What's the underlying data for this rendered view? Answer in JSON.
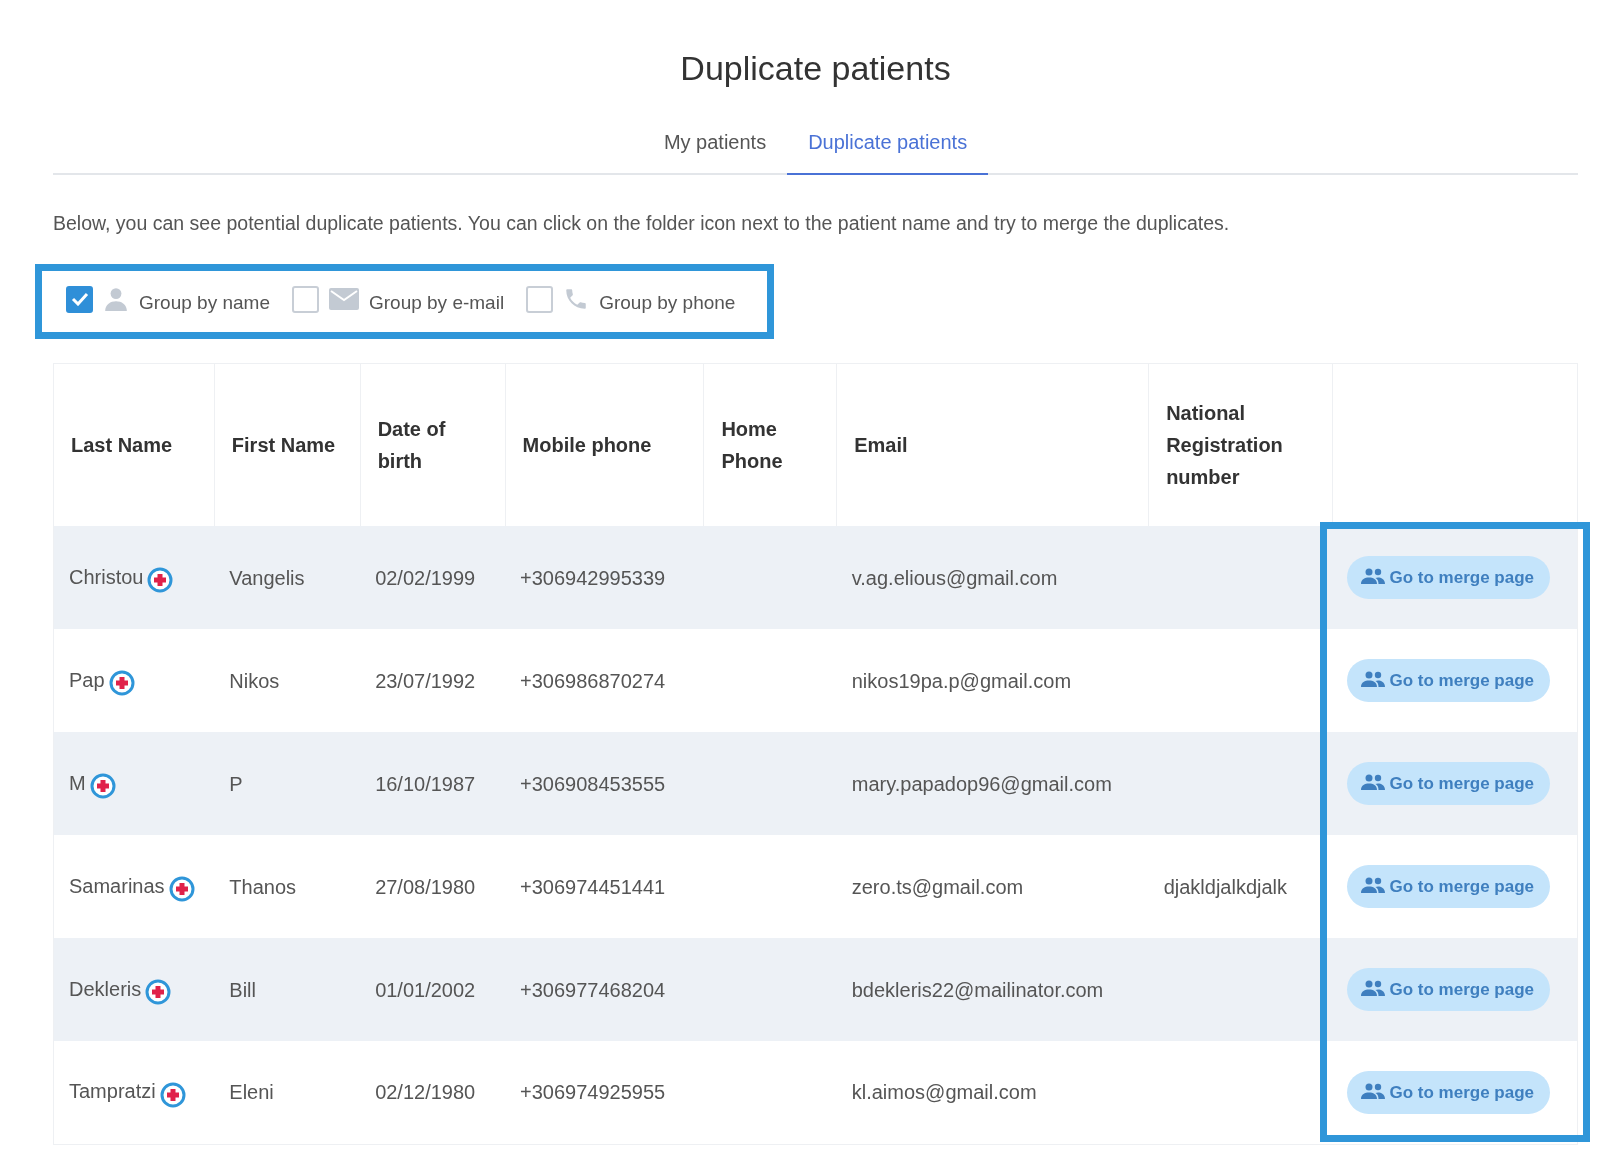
{
  "title": "Duplicate patients",
  "tabs": [
    {
      "label": "My patients",
      "selected": false
    },
    {
      "label": "Duplicate patients",
      "selected": true
    }
  ],
  "description": "Below, you can see potential duplicate patients. You can click on the folder icon next to the patient name and try to merge the duplicates.",
  "filters": {
    "highlighted": true,
    "items": [
      {
        "kind": "name",
        "label": "Group by name",
        "checked": true
      },
      {
        "kind": "email",
        "label": "Group by e-mail",
        "checked": false
      },
      {
        "kind": "phone",
        "label": "Group by phone",
        "checked": false
      }
    ]
  },
  "table": {
    "columns": [
      "Last Name",
      "First Name",
      "Date of birth",
      "Mobile phone",
      "Home Phone",
      "Email",
      "National Registration number",
      ""
    ],
    "action_column_highlighted": true,
    "rows": [
      {
        "last_name": "Christou",
        "first_name": "Vangelis",
        "date_of_birth": "02/02/1999",
        "mobile_phone": "+306942995339",
        "home_phone": "",
        "email": "v.ag.elious@gmail.com",
        "national_registration_number": "",
        "action": "Go to merge page"
      },
      {
        "last_name": "Pap",
        "first_name": "Nikos",
        "date_of_birth": "23/07/1992",
        "mobile_phone": "+306986870274",
        "home_phone": "",
        "email": "nikos19pa.p@gmail.com",
        "national_registration_number": "",
        "action": "Go to merge page"
      },
      {
        "last_name": "M",
        "first_name": "P",
        "date_of_birth": "16/10/1987",
        "mobile_phone": "+306908453555",
        "home_phone": "",
        "email": "mary.papadop96@gmail.com",
        "national_registration_number": "",
        "action": "Go to merge page"
      },
      {
        "last_name": "Samarinas",
        "first_name": "Thanos",
        "date_of_birth": "27/08/1980",
        "mobile_phone": "+306974451441",
        "home_phone": "",
        "email": "zero.ts@gmail.com",
        "national_registration_number": "djakldjalkdjalk",
        "action": "Go to merge page"
      },
      {
        "last_name": "Dekleris",
        "first_name": "Bill",
        "date_of_birth": "01/01/2002",
        "mobile_phone": "+306977468204",
        "home_phone": "",
        "email": "bdekleris22@mailinator.com",
        "national_registration_number": "",
        "action": "Go to merge page"
      },
      {
        "last_name": "Tampratzi",
        "first_name": "Eleni",
        "date_of_birth": "02/12/1980",
        "mobile_phone": "+306974925955",
        "home_phone": "",
        "email": "kl.aimos@gmail.com",
        "national_registration_number": "",
        "action": "Go to merge page"
      }
    ]
  }
}
